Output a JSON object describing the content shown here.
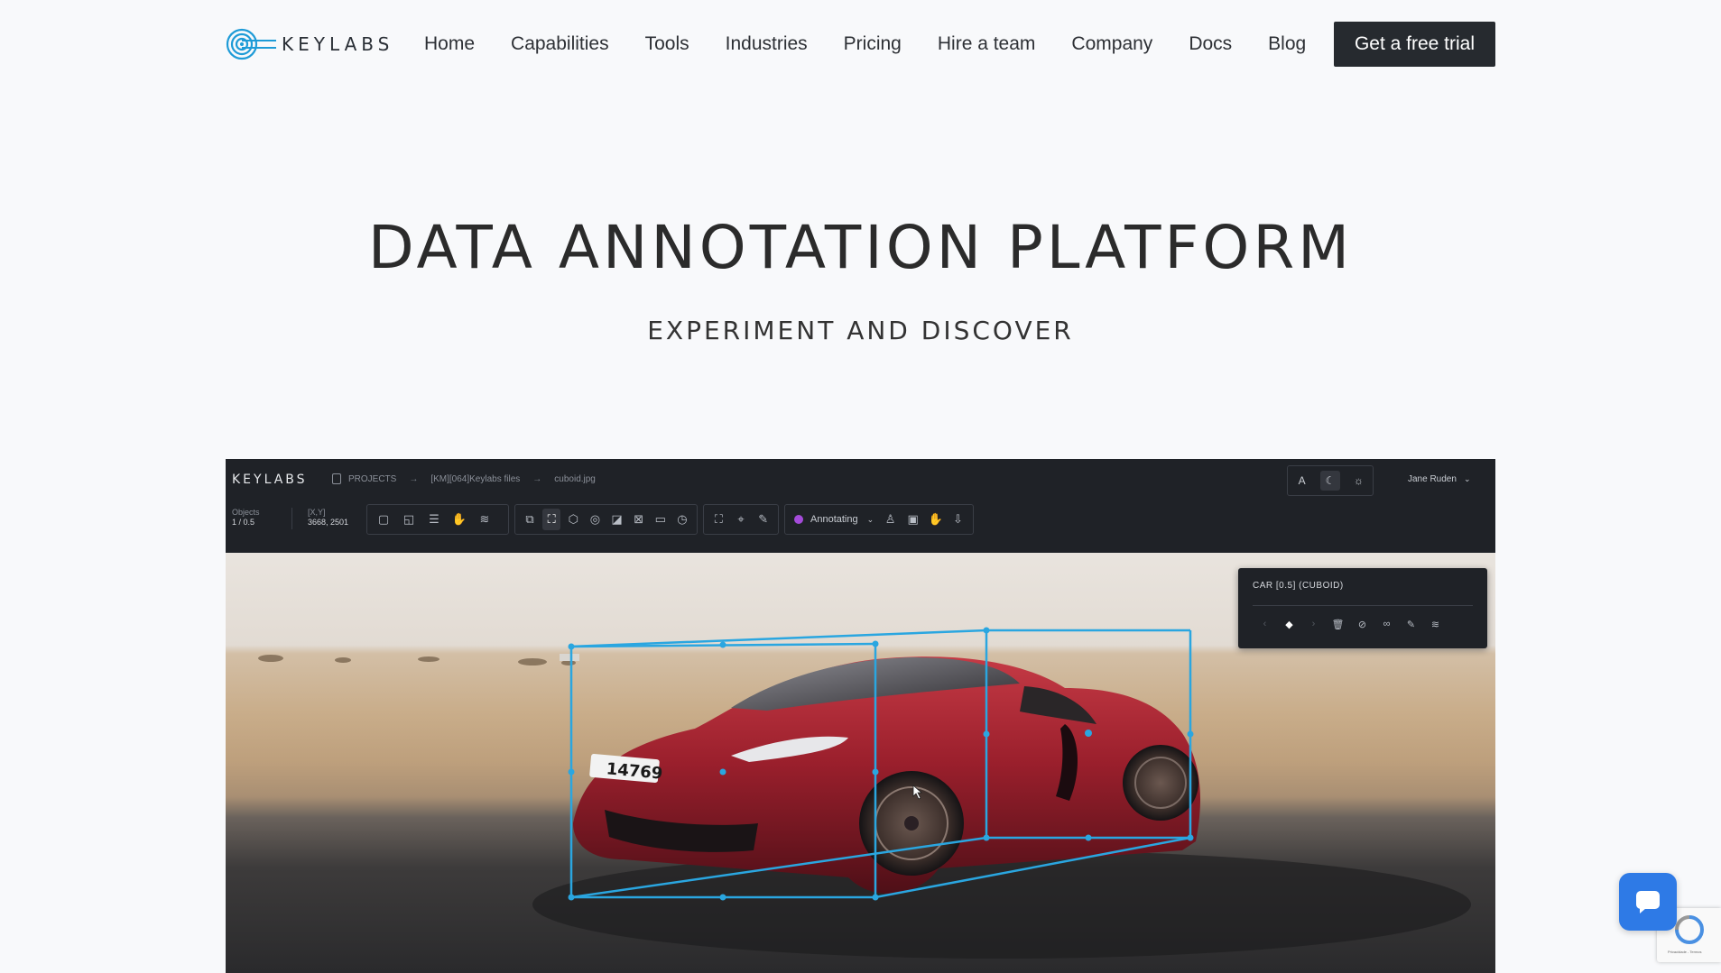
{
  "header": {
    "logo_text": "KEYLABS",
    "nav": [
      "Home",
      "Capabilities",
      "Tools",
      "Industries",
      "Pricing",
      "Hire a team",
      "Company",
      "Docs",
      "Blog"
    ],
    "cta_label": "Get a free trial"
  },
  "hero": {
    "title": "DATA ANNOTATION PLATFORM",
    "subtitle": "EXPERIMENT AND DISCOVER"
  },
  "app": {
    "logo_text": "KEYLABS",
    "breadcrumbs": [
      "PROJECTS",
      "[KM][064]Keylabs files",
      "cuboid.jpg"
    ],
    "view_toggle": [
      "A",
      "moon-icon",
      "sun-icon"
    ],
    "user_name": "Jane Ruden",
    "objects_label": "Objects",
    "objects_value": "1 / 0.5",
    "coords_label": "[X,Y]",
    "coords_value": "3668, 2501",
    "status_label": "Annotating",
    "status_color": "#a44bd9",
    "object_panel_title": "CAR [0.5] (CUBOID)",
    "plate_text": "14769"
  },
  "colors": {
    "cta_bg": "#262a2f",
    "accent": "#2e7ae6",
    "cuboid": "#2aa6e0"
  },
  "recaptcha_text": "Privacidade - Termos"
}
